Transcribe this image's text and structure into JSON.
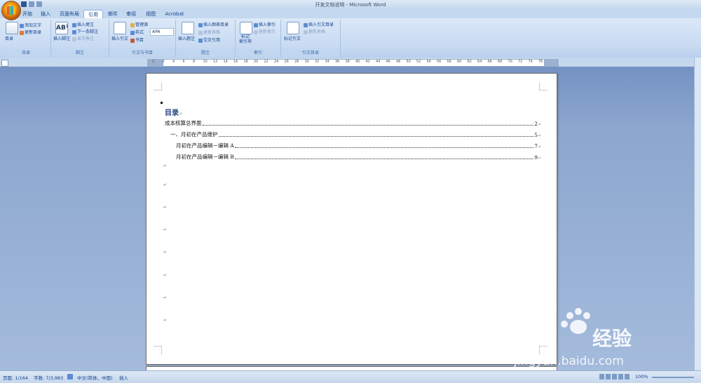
{
  "window": {
    "title": "开发文档说明 - Microsoft Word"
  },
  "tabs": [
    "开始",
    "插入",
    "页面布局",
    "引用",
    "邮件",
    "审阅",
    "视图",
    "Acrobat"
  ],
  "active_tab": "引用",
  "ribbon": {
    "toc_group": {
      "toc_button": "目录",
      "add_text": "添加文字",
      "update_toc": "更新目录",
      "label": "目录"
    },
    "footnote_group": {
      "insert_footnote": "插入脚注",
      "insert_endnote": "插入尾注",
      "next_footnote": "下一条脚注",
      "show_notes": "显示备注",
      "label": "脚注"
    },
    "citation_group": {
      "insert_citation": "插入引文",
      "manage_sources": "管理源",
      "style_label": "样式",
      "style_value": "APA",
      "bibliography": "书目",
      "label": "引文与书目"
    },
    "caption_group": {
      "insert_caption": "插入题注",
      "insert_table_of_figures": "插入图表目录",
      "update_table": "更新表格",
      "cross_reference": "交叉引用",
      "label": "题注"
    },
    "index_group": {
      "mark_entry": "标记\n索引项",
      "insert_index": "插入索引",
      "update_index": "更新索引",
      "label": "索引"
    },
    "toa_group": {
      "mark_citation": "标记引文",
      "insert_toa": "插入引文目录",
      "update_table": "更新表格",
      "label": "引文目录"
    }
  },
  "ruler": {
    "marks": [
      "2",
      "2",
      "4",
      "6",
      "8",
      "10",
      "12",
      "14",
      "16",
      "18",
      "20",
      "22",
      "24",
      "26",
      "28",
      "30",
      "32",
      "34",
      "36",
      "38",
      "40",
      "42",
      "44",
      "46",
      "48",
      "50",
      "52",
      "54",
      "56",
      "58",
      "60",
      "62",
      "64",
      "66",
      "68",
      "70",
      "72",
      "74",
      "76"
    ]
  },
  "document": {
    "heading": "目录",
    "entries": [
      {
        "text": "成本核算总界面",
        "page": "2"
      },
      {
        "text": "一、月初在产品维护",
        "page": "5"
      },
      {
        "text": "月初在产品编辑－编辑 A",
        "page": "7"
      },
      {
        "text": "月初在产品编辑－编辑 B",
        "page": "9"
      }
    ],
    "para_mark": "↵"
  },
  "status": {
    "page": "页面: 1/164",
    "words": "字数: 7/3,983",
    "language": "中文(简体，中国)",
    "mode": "插入",
    "zoom": "100%"
  },
  "watermark": {
    "brand": "Baidu经验",
    "url": "jingyan.baidu.com"
  },
  "colors": {
    "ribbon": "#c8dbf2",
    "doc_bg": "#8ca6ce",
    "heading": "#1f3f7a"
  }
}
